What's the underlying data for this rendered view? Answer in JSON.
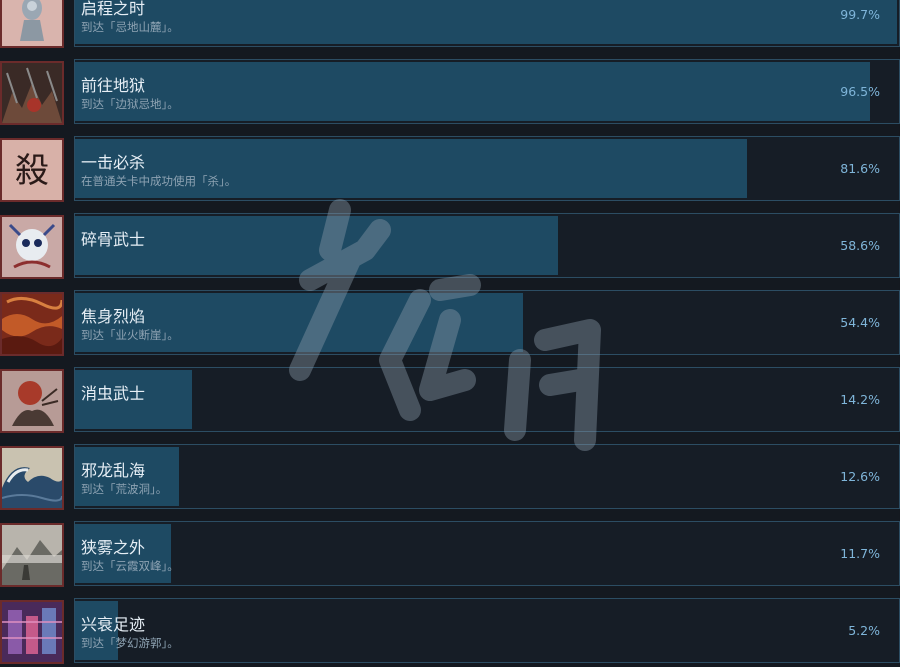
{
  "achievements": [
    {
      "title": "启程之时",
      "description": "到达「忌地山麓」。",
      "percent_label": "99.7%",
      "percent": 99.7,
      "icon": "priestess-statue-icon"
    },
    {
      "title": "前往地狱",
      "description": "到达「边狱忌地」。",
      "percent_label": "96.5%",
      "percent": 96.5,
      "icon": "hell-gate-icon"
    },
    {
      "title": "一击必杀",
      "description": "在普通关卡中成功使用「杀」。",
      "percent_label": "81.6%",
      "percent": 81.6,
      "icon": "kill-kanji-icon",
      "icon_text": "殺"
    },
    {
      "title": "碎骨武士",
      "description": "",
      "percent_label": "58.6%",
      "percent": 58.6,
      "icon": "skeleton-samurai-icon"
    },
    {
      "title": "焦身烈焰",
      "description": "到达「业火断崖」。",
      "percent_label": "54.4%",
      "percent": 54.4,
      "icon": "flame-cliff-icon"
    },
    {
      "title": "消虫武士",
      "description": "",
      "percent_label": "14.2%",
      "percent": 14.2,
      "icon": "bug-samurai-icon"
    },
    {
      "title": "邪龙乱海",
      "description": "到达「荒波洞」。",
      "percent_label": "12.6%",
      "percent": 12.6,
      "icon": "great-wave-icon"
    },
    {
      "title": "狭雾之外",
      "description": "到达「云霞双峰」。",
      "percent_label": "11.7%",
      "percent": 11.7,
      "icon": "misty-peaks-icon"
    },
    {
      "title": "兴衰足迹",
      "description": "到达「梦幻游郭」。",
      "percent_label": "5.2%",
      "percent": 5.2,
      "icon": "pleasure-quarter-icon"
    }
  ],
  "colors": {
    "background": "#141920",
    "bar_fill": "#1e4a63",
    "bar_border": "#2c4d63",
    "percent_text": "#7fb5d9",
    "icon_border": "#6b2b2b"
  },
  "watermark": "游侠网"
}
